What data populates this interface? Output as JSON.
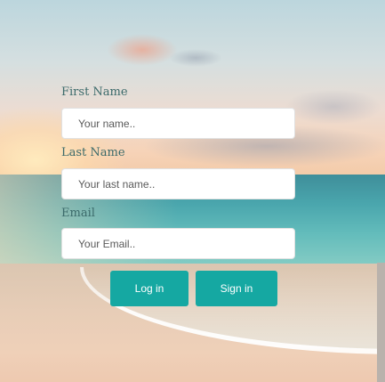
{
  "form": {
    "first_name": {
      "label": "First Name",
      "placeholder": "Your name.."
    },
    "last_name": {
      "label": "Last Name",
      "placeholder": "Your last name.."
    },
    "email": {
      "label": "Email",
      "placeholder": "Your Email.."
    },
    "buttons": {
      "login": "Log in",
      "signin": "Sign in"
    }
  },
  "colors": {
    "button": "#15a8a2",
    "label": "#3b6a6a"
  }
}
